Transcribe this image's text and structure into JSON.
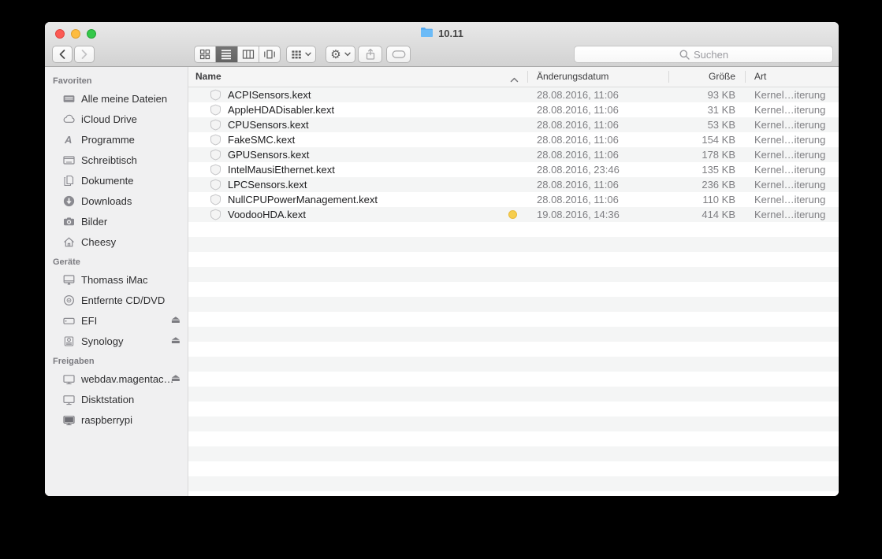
{
  "window": {
    "title": "10.11"
  },
  "toolbar": {
    "search_placeholder": "Suchen"
  },
  "icons": {
    "eject_glyph": "⏏",
    "gear_glyph": "⚙"
  },
  "sidebar": {
    "sections": [
      {
        "title": "Favoriten",
        "items": [
          {
            "label": "Alle meine Dateien"
          },
          {
            "label": "iCloud Drive"
          },
          {
            "label": "Programme"
          },
          {
            "label": "Schreibtisch"
          },
          {
            "label": "Dokumente"
          },
          {
            "label": "Downloads"
          },
          {
            "label": "Bilder"
          },
          {
            "label": "Cheesy"
          }
        ]
      },
      {
        "title": "Geräte",
        "items": [
          {
            "label": "Thomass iMac"
          },
          {
            "label": "Entfernte CD/DVD"
          },
          {
            "label": "EFI",
            "eject": true
          },
          {
            "label": "Synology",
            "eject": true
          }
        ]
      },
      {
        "title": "Freigaben",
        "items": [
          {
            "label": "webdav.magentac…",
            "eject": true
          },
          {
            "label": "Disktstation"
          },
          {
            "label": "raspberrypi"
          }
        ]
      }
    ]
  },
  "list": {
    "columns": {
      "name": "Name",
      "date": "Änderungsdatum",
      "size": "Größe",
      "kind": "Art"
    },
    "sort_column": "Name",
    "sort_direction": "ascending",
    "rows": [
      {
        "name": "ACPISensors.kext",
        "date": "28.08.2016, 11:06",
        "size": "93 KB",
        "kind": "Kernel…iterung"
      },
      {
        "name": "AppleHDADisabler.kext",
        "date": "28.08.2016, 11:06",
        "size": "31 KB",
        "kind": "Kernel…iterung"
      },
      {
        "name": "CPUSensors.kext",
        "date": "28.08.2016, 11:06",
        "size": "53 KB",
        "kind": "Kernel…iterung"
      },
      {
        "name": "FakeSMC.kext",
        "date": "28.08.2016, 11:06",
        "size": "154 KB",
        "kind": "Kernel…iterung"
      },
      {
        "name": "GPUSensors.kext",
        "date": "28.08.2016, 11:06",
        "size": "178 KB",
        "kind": "Kernel…iterung"
      },
      {
        "name": "IntelMausiEthernet.kext",
        "date": "28.08.2016, 23:46",
        "size": "135 KB",
        "kind": "Kernel…iterung"
      },
      {
        "name": "LPCSensors.kext",
        "date": "28.08.2016, 11:06",
        "size": "236 KB",
        "kind": "Kernel…iterung"
      },
      {
        "name": "NullCPUPowerManagement.kext",
        "date": "28.08.2016, 11:06",
        "size": "110 KB",
        "kind": "Kernel…iterung"
      },
      {
        "name": "VoodooHDA.kext",
        "date": "19.08.2016, 14:36",
        "size": "414 KB",
        "kind": "Kernel…iterung",
        "tag_color": "#f6ce4e"
      }
    ]
  }
}
